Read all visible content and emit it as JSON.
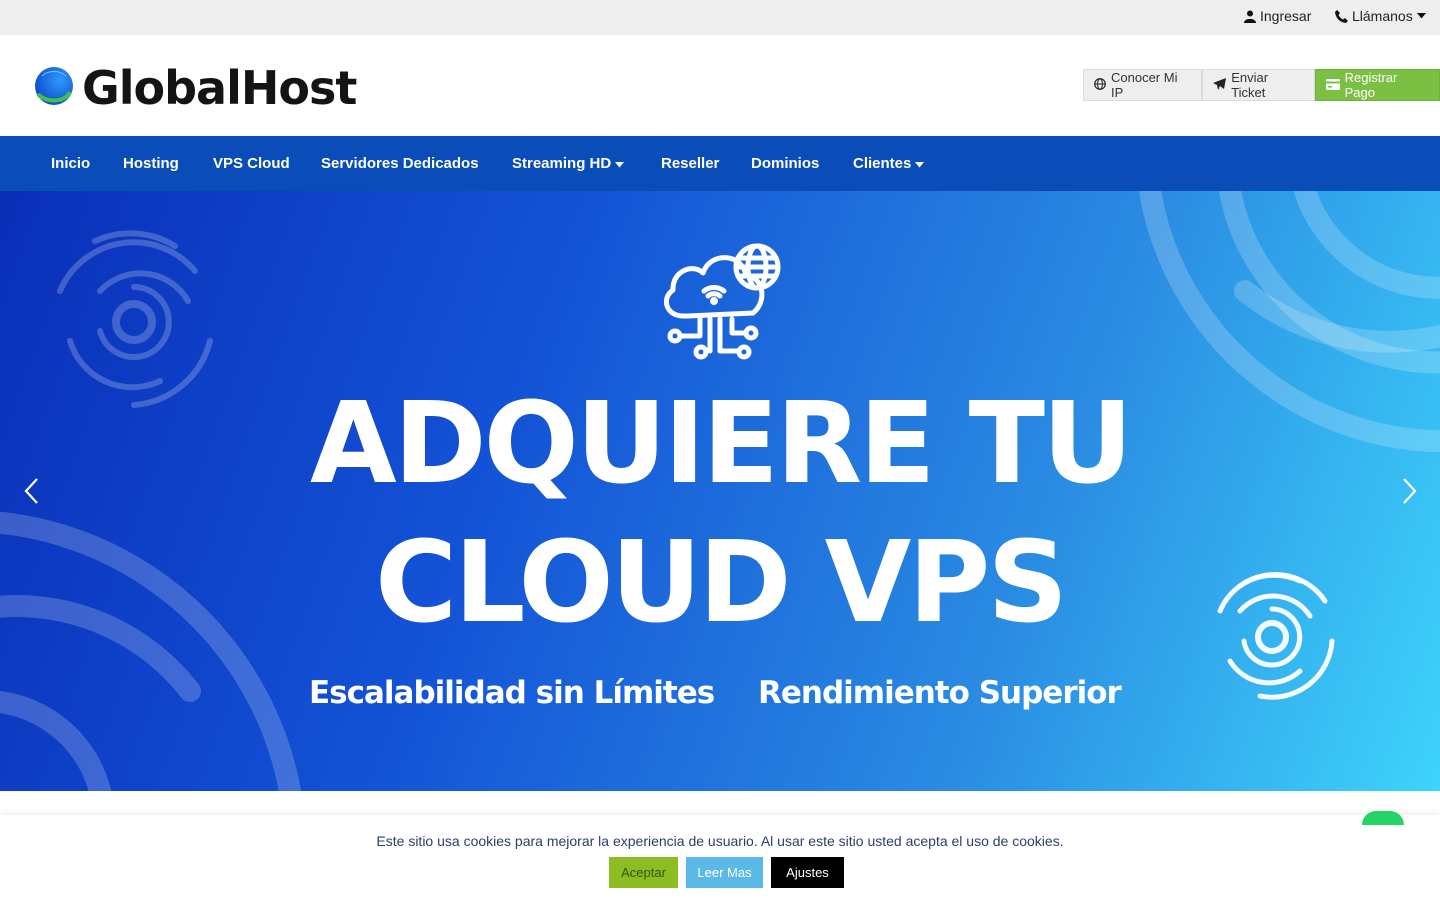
{
  "topbar": {
    "login_label": "Ingresar",
    "call_label": "Llámanos"
  },
  "header": {
    "logo_text": "GlobalHost",
    "buttons": {
      "ip": "Conocer Mi IP",
      "ticket": "Enviar Ticket",
      "payment": "Registrar Pago"
    }
  },
  "nav": {
    "items": [
      "Inicio",
      "Hosting",
      "VPS Cloud",
      "Servidores Dedicados",
      "Streaming HD",
      "Reseller",
      "Dominios",
      "Clientes"
    ]
  },
  "hero": {
    "title_line1": "ADQUIERE TU",
    "title_line2": "CLOUD VPS",
    "subtitle_left": "Escalabilidad sin Límites",
    "subtitle_right": "Rendimiento Superior"
  },
  "cookie": {
    "message": "Este sitio usa cookies para mejorar la experiencia de usuario. Al usar este sitio usted acepta el uso de cookies.",
    "accept": "Aceptar",
    "read_more": "Leer Mas",
    "settings": "Ajustes"
  },
  "colors": {
    "nav_bg": "#0a4db8",
    "payment_green": "#7cc043",
    "hero_start": "#0a2fb8",
    "hero_end": "#3ed4fb"
  },
  "icons": [
    "user-icon",
    "phone-icon",
    "caret-down-icon",
    "globe-icon",
    "paper-plane-icon",
    "credit-card-icon",
    "cloud-network-icon",
    "chevron-left-icon",
    "chevron-right-icon",
    "whatsapp-icon"
  ]
}
